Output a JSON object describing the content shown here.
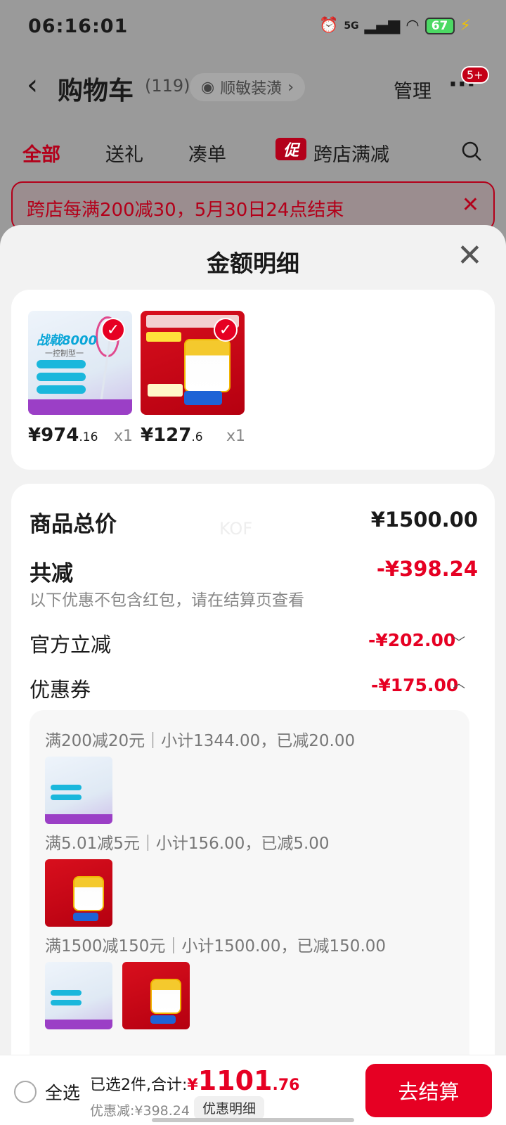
{
  "status": {
    "time": "06:16:01",
    "network": "5G",
    "battery": "67"
  },
  "header": {
    "title": "购物车",
    "count": "(119)",
    "address": "顺敏装潢",
    "manage": "管理",
    "badge": "5+"
  },
  "tabs": [
    {
      "label": "全部",
      "active": true
    },
    {
      "label": "送礼"
    },
    {
      "label": "凑单"
    },
    {
      "label": "跨店满减",
      "tag": "促"
    }
  ],
  "promo": {
    "text": "跨店每满200减30，5月30日24点结束"
  },
  "sheet": {
    "title": "金额明细",
    "products": [
      {
        "name": "racket",
        "price_int": "¥974",
        "price_dec": ".16",
        "qty": "x1",
        "thumb_text": {
          "logo": "战戟8000",
          "sub": "一控制型一"
        }
      },
      {
        "name": "milk",
        "price_int": "¥127",
        "price_dec": ".6",
        "qty": "x1"
      }
    ],
    "total": {
      "label": "商品总价",
      "value": "¥1500.00"
    },
    "reduce": {
      "label": "共减",
      "value": "-¥398.24",
      "note": "以下优惠不包含红包，请在结算页查看"
    },
    "official": {
      "label": "官方立减",
      "value": "-¥202.00"
    },
    "coupon": {
      "label": "优惠券",
      "value": "-¥175.00"
    },
    "watermark": "KOF",
    "coupons": [
      {
        "text": "满200减20元｜小计1344.00，已减20.00"
      },
      {
        "text": "满5.01减5元｜小计156.00，已减5.00"
      },
      {
        "text": "满1500减150元｜小计1500.00，已减150.00"
      }
    ]
  },
  "bottom": {
    "select_all": "全选",
    "summary_prefix": "已选2件,合计:",
    "currency": "¥",
    "total_int": "1101",
    "total_dec": ".76",
    "discount": "优惠减:¥398.24",
    "detail": "优惠明细",
    "checkout": "去结算"
  },
  "colors": {
    "accent": "#e60023",
    "dim": "#9a9a9a"
  }
}
